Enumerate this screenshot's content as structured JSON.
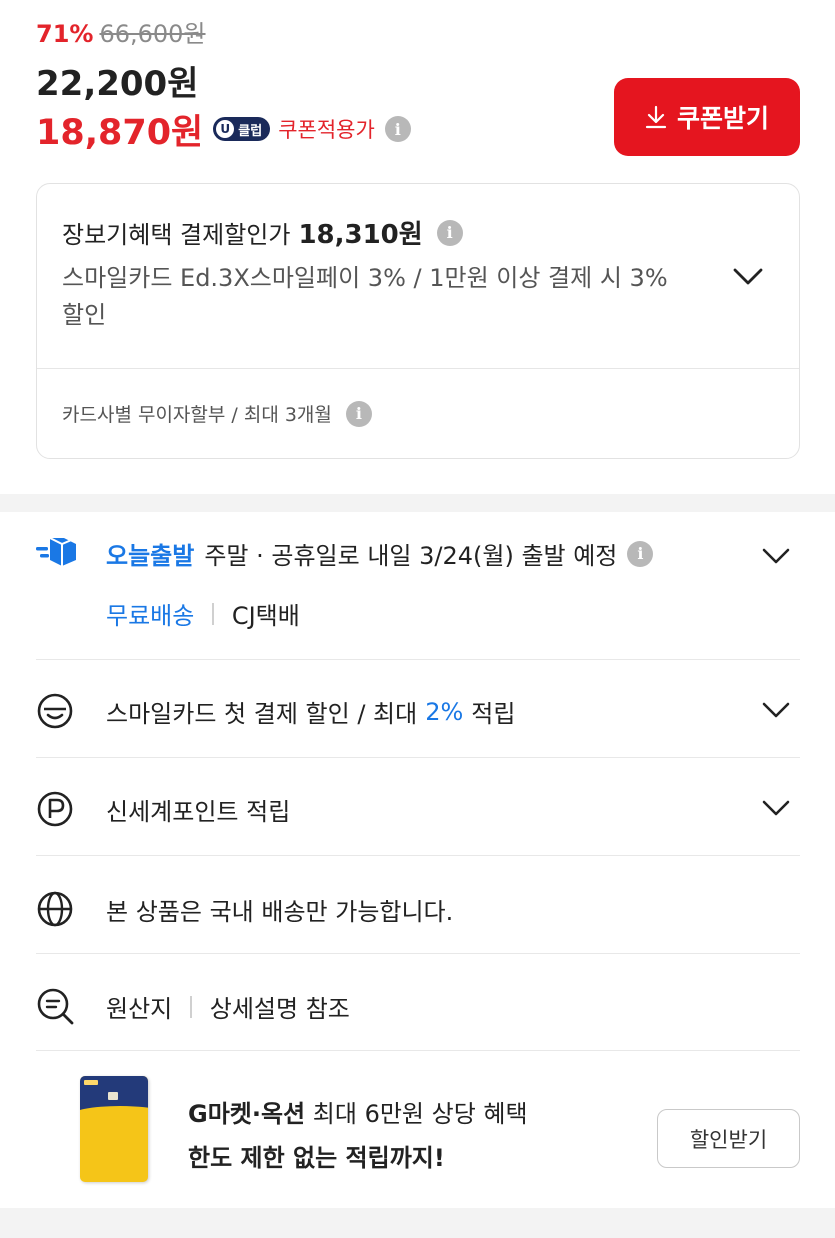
{
  "price": {
    "discount_rate": "71%",
    "original_price": "66,600원",
    "sale_price": "22,200원",
    "coupon_price": "18,870원",
    "badge_label": "클럽",
    "badge_letter": "U",
    "coupon_label": "쿠폰적용가",
    "coupon_button_label": "쿠폰받기"
  },
  "benefit": {
    "title": "장보기혜택 결제할인가",
    "price": "18,310원",
    "description": "스마일카드 Ed.3X스마일페이 3% / 1만원 이상 결제 시 3% 할인",
    "installment": "카드사별 무이자할부 / 최대 3개월"
  },
  "shipping": {
    "brand": "오늘출발",
    "text": "주말 · 공휴일로 내일 3/24(월) 출발 예정",
    "free_label": "무료배송",
    "carrier": "CJ택배"
  },
  "smilecard": {
    "text_before": "스마일카드 첫 결제 할인 / 최대",
    "percent": "2%",
    "text_after": "적립"
  },
  "points": {
    "text": "신세계포인트 적립"
  },
  "domestic": {
    "text": "본 상품은 국내 배송만 가능합니다."
  },
  "origin": {
    "label": "원산지",
    "value": "상세설명 참조"
  },
  "promo": {
    "brand": "G마켓·옥션",
    "line1_rest": "최대 6만원 상당 혜택",
    "line2": "한도 제한 없는 적립까지!",
    "button_label": "할인받기"
  },
  "icons": {
    "info": "info-icon",
    "chevron": "chevron-down-icon",
    "download": "download-icon",
    "truck": "delivery-truck-icon",
    "smile": "smile-card-icon",
    "point": "point-p-icon",
    "globe": "globe-icon",
    "search": "search-list-icon"
  },
  "colors": {
    "accent_red": "#e5151f",
    "accent_blue": "#1a78e5",
    "badge_navy": "#1a2a5a"
  }
}
